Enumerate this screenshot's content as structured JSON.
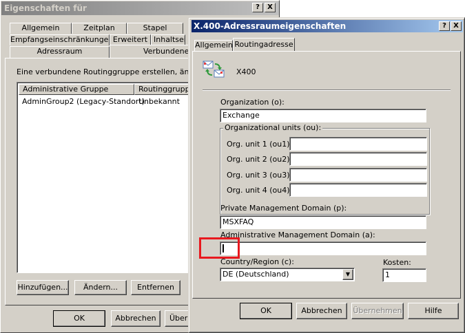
{
  "background_window": {
    "title": "Eigenschaften für",
    "help_btn": "?",
    "close_btn": "X",
    "tabs_row1": [
      "Allgemein",
      "Zeitplan",
      "Stapel"
    ],
    "tabs_row2": [
      "Empfangseinschränkungen",
      "Erweitert",
      "Inhaltseins"
    ],
    "tabs_row3": [
      "Adressraum",
      "Verbundene I"
    ],
    "description": "Eine verbundene Routinggruppe erstellen, ändern od",
    "list_columns": [
      "Administrative Gruppe",
      "Routinggruppe"
    ],
    "list_rows": [
      {
        "group": "AdminGroup2 (Legacy-Standort)",
        "routing": "Unbekannt"
      }
    ],
    "buttons": {
      "add": "Hinzufügen...",
      "edit": "Ändern...",
      "remove": "Entfernen"
    },
    "footer": {
      "ok": "OK",
      "cancel": "Abbrechen",
      "apply": "Übern"
    }
  },
  "dialog": {
    "title": "X.400-Adressraumeigenschaften",
    "help_btn": "?",
    "close_btn": "X",
    "tabs": [
      "Allgemein",
      "Routingadresse"
    ],
    "address_type": "X400",
    "organization_label": "Organization (o):",
    "organization_value": "Exchange",
    "ou_group_label": "Organizational units (ou):",
    "ou_labels": [
      "Org. unit 1 (ou1):",
      "Org. unit 2 (ou2):",
      "Org. unit 3 (ou3):",
      "Org. unit 4 (ou4):"
    ],
    "ou_values": [
      "",
      "",
      "",
      ""
    ],
    "prmd_label": "Private Management Domain (p):",
    "prmd_value": "MSXFAQ",
    "admd_label": "Administrative Management Domain (a):",
    "admd_value": "",
    "country_label": "Country/Region (c):",
    "country_value": "DE (Deutschland)",
    "cost_label": "Kosten:",
    "cost_value": "1",
    "footer": {
      "ok": "OK",
      "cancel": "Abbrechen",
      "apply": "Übernehmen",
      "help": "Hilfe"
    }
  },
  "colors": {
    "highlight": "#e8181e",
    "title_active": "#0a246a",
    "face": "#d4d0c8"
  }
}
